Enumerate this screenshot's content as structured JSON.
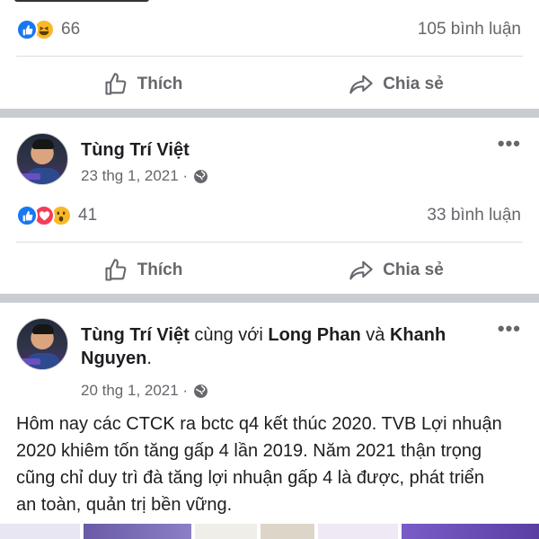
{
  "post_top": {
    "partial_text": "",
    "reaction_count": "66",
    "comments": "105 bình luận",
    "like_label": "Thích",
    "share_label": "Chia sẻ"
  },
  "post_1": {
    "author": "Tùng Trí Việt",
    "date": "23 thg 1, 2021 ·",
    "reaction_count": "41",
    "comments": "33 bình luận",
    "like_label": "Thích",
    "share_label": "Chia sẻ",
    "more": "•••"
  },
  "post_2": {
    "author": "Tùng Trí Việt",
    "with_text": " cùng với ",
    "tagged_1": "Long Phan",
    "and_text": " và ",
    "tagged_2": "Khanh Nguyen",
    "end": ".",
    "date": "20 thg 1, 2021 ·",
    "more": "•••",
    "body": "Hôm nay các CTCK ra bctc q4 kết thúc 2020. TVB Lợi nhuận 2020 khiêm tốn tăng gấp 4 lần 2019. Năm 2021 thận trọng cũng chỉ duy trì đà tăng lợi nhuận gấp 4 là được, phát triển an toàn, quản trị bền vững."
  },
  "icons": [
    "like-reaction-icon",
    "haha-reaction-icon",
    "love-reaction-icon",
    "wow-reaction-icon",
    "thumbs-up-icon",
    "share-arrow-icon",
    "globe-icon",
    "more-icon"
  ],
  "colors": {
    "like_blue": "#1877f2",
    "love_red": "#f33e58",
    "yellow": "#f7b928",
    "secondary_text": "#65676b",
    "separator": "#c9ccd1"
  }
}
